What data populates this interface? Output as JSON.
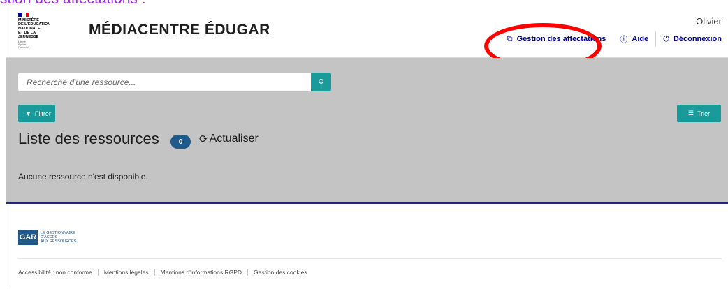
{
  "caption": "stion des affectations :",
  "header": {
    "ministry_lines": [
      "MINISTÈRE",
      "DE L'ÉDUCATION",
      "NATIONALE",
      "ET DE LA JEUNESSE"
    ],
    "motto_lines": [
      "Liberté",
      "Égalité",
      "Fraternité"
    ],
    "brand": "MÉDIACENTRE ÉDUGAR",
    "user_name": "Olivier",
    "nav": {
      "affectations": "Gestion des affectations",
      "aide": "Aide",
      "logout": "Déconnexion"
    }
  },
  "main": {
    "search_placeholder": "Recherche d'une ressource...",
    "filter_label": "Filtrer",
    "sort_label": "Trier",
    "list_title": "Liste des ressources",
    "count": "0",
    "refresh_label": "Actualiser",
    "empty_message": "Aucune ressource n'est disponible."
  },
  "footer": {
    "gar_abbr": "GAR",
    "gar_text_lines": [
      "LE GESTIONNAIRE",
      "D'ACCÈS",
      "AUX RESSOURCES"
    ],
    "links": [
      "Accessibilité : non conforme",
      "Mentions légales",
      "Mentions d'informations RGPD",
      "Gestion des cookies"
    ]
  },
  "colors": {
    "teal": "#1a9a9a",
    "navy": "#000091",
    "badge": "#1f5a8a",
    "highlight": "#ff0000",
    "caption": "#a020f0"
  },
  "icons": {
    "external": "external-link-icon",
    "help": "help-circle-icon",
    "logout": "power-icon",
    "search": "search-icon",
    "filter": "filter-icon",
    "sort": "sort-icon",
    "refresh": "refresh-icon"
  }
}
